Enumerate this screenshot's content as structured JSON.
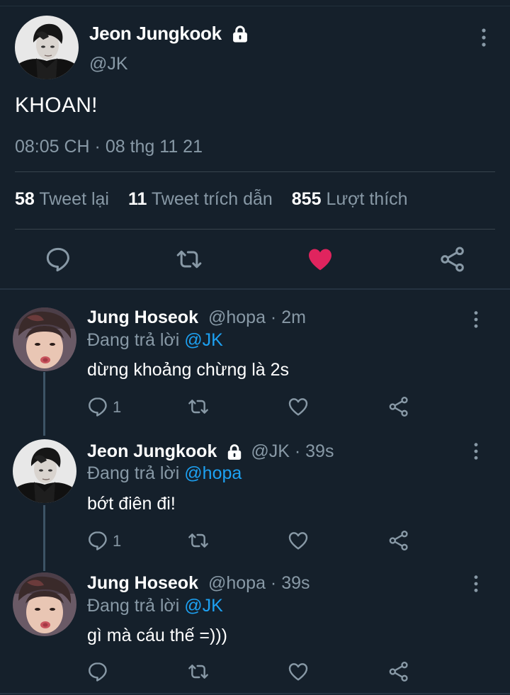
{
  "main_tweet": {
    "author_name": "Jeon Jungkook",
    "author_handle": "@JK",
    "text": "KHOAN!",
    "timestamp": "08:05 CH · 08 thg 11 21",
    "stats": {
      "retweets_count": "58",
      "retweets_label": "Tweet lại",
      "quotes_count": "11",
      "quotes_label": "Tweet trích dẫn",
      "likes_count": "855",
      "likes_label": "Lượt thích"
    },
    "liked": true,
    "like_color": "#e0245e"
  },
  "replies": [
    {
      "name": "Jung Hoseok",
      "meta": "@hopa · 2m",
      "replying_prefix": "Đang trả lời",
      "replying_to": "@JK",
      "text": "dừng khoảng chừng là 2s",
      "reply_count": "1",
      "locked": false
    },
    {
      "name": "Jeon Jungkook",
      "meta": "@JK · 39s",
      "replying_prefix": "Đang trả lời",
      "replying_to": "@hopa",
      "text": "bớt điên đi!",
      "reply_count": "1",
      "locked": true
    },
    {
      "name": "Jung Hoseok",
      "meta": "@hopa · 39s",
      "replying_prefix": "Đang trả lời",
      "replying_to": "@JK",
      "text": "gì mà cáu thế =)))",
      "reply_count": "",
      "locked": false
    }
  ],
  "colors": {
    "background": "#15202b",
    "secondary_text": "#8899a6",
    "mention": "#1da1f2",
    "like": "#e0245e"
  },
  "icons": [
    "lock-icon",
    "more-icon",
    "reply-icon",
    "retweet-icon",
    "like-icon",
    "share-icon"
  ]
}
